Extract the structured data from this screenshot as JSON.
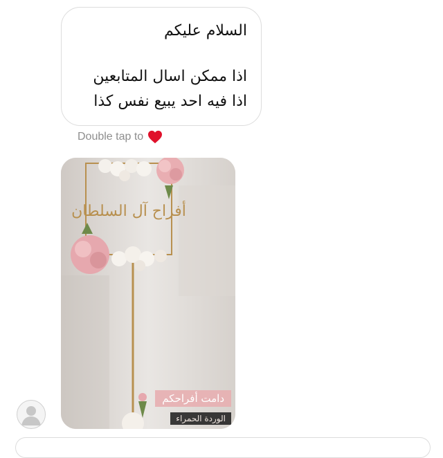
{
  "message": {
    "line1": "السلام عليكم",
    "line2": "اذا ممكن اسال المتابعين",
    "line3": "اذا فيه احد يبيع نفس كذا"
  },
  "reaction_hint": {
    "text": "Double tap to",
    "icon": "heart-icon",
    "heart_color": "#e0112b"
  },
  "photo": {
    "artwork_text": "أفراح آل السلطان",
    "caption_pink": "دامت أفراحكم",
    "caption_dark": "الوردة الحمراء"
  },
  "colors": {
    "bubble_border": "#dcdcdc",
    "hint_text": "#8e8e8e",
    "caption_pink_bg": "#e7b0b2",
    "gold": "#b8904f"
  }
}
